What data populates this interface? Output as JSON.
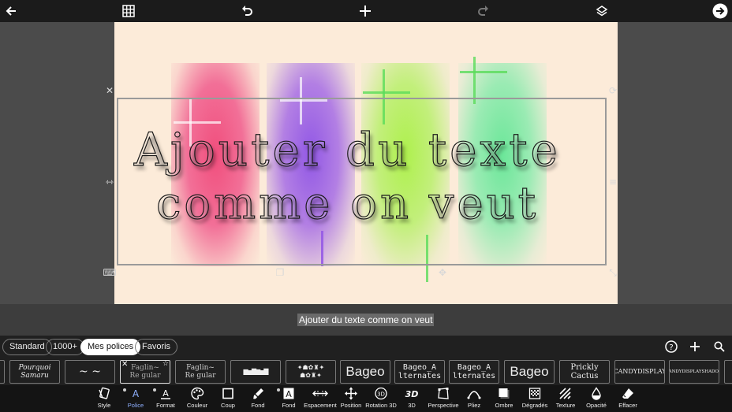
{
  "canvas": {
    "line1": "Ajouter du texte",
    "line2": "comme on veut"
  },
  "text_field": {
    "value": "Ajouter du texte comme on veut"
  },
  "categories": {
    "standard": "Standard",
    "thousand": "1000+",
    "mine": "Mes polices",
    "favorites": "Favoris"
  },
  "fonts": [
    {
      "label": "Pourquoi\nSamaru"
    },
    {
      "label": "~ ~"
    },
    {
      "label": "Faglin~\nRe gular"
    },
    {
      "label": "Faglin~\nRe gular"
    },
    {
      "label": "▆▅▇▆▅▇"
    },
    {
      "label": "✦☗✿♜✦\n☗✿♜✦"
    },
    {
      "label": "Bageo"
    },
    {
      "label": "Bageo_A\nlternates"
    },
    {
      "label": "Bageo_A\nlternates"
    },
    {
      "label": "Bageo"
    },
    {
      "label": "Prickly\nCactus"
    },
    {
      "label": "CANDYDISPLAY"
    },
    {
      "label": "CANDYDISPLAYSHADOW"
    }
  ],
  "tools": [
    {
      "name": "style",
      "label": "Style",
      "icon": "style-icon"
    },
    {
      "name": "police",
      "label": "Police",
      "icon": "font-icon",
      "active": true
    },
    {
      "name": "format",
      "label": "Format",
      "icon": "format-icon"
    },
    {
      "name": "couleur",
      "label": "Couleur",
      "icon": "palette-icon"
    },
    {
      "name": "coup",
      "label": "Coup",
      "icon": "stroke-icon"
    },
    {
      "name": "fond",
      "label": "Fond",
      "icon": "brush-icon"
    },
    {
      "name": "fond2",
      "label": "Fond",
      "icon": "text-bg-icon"
    },
    {
      "name": "espacement",
      "label": "Espacement",
      "icon": "spacing-icon"
    },
    {
      "name": "position",
      "label": "Position",
      "icon": "move-icon"
    },
    {
      "name": "rotation3d",
      "label": "Rotation 3D",
      "icon": "rotate-3d-icon"
    },
    {
      "name": "3d",
      "label": "3D",
      "icon": "3d-icon"
    },
    {
      "name": "perspective",
      "label": "Perspective",
      "icon": "perspective-icon"
    },
    {
      "name": "pliez",
      "label": "Pliez",
      "icon": "curve-icon"
    },
    {
      "name": "ombre",
      "label": "Ombre",
      "icon": "shadow-icon"
    },
    {
      "name": "degrades",
      "label": "Dégradés",
      "icon": "gradient-icon"
    },
    {
      "name": "texture",
      "label": "Texture",
      "icon": "texture-icon"
    },
    {
      "name": "opacite",
      "label": "Opacité",
      "icon": "opacity-icon"
    },
    {
      "name": "effacer",
      "label": "Effacer",
      "icon": "eraser-icon"
    }
  ],
  "colors": {
    "accent": "#8fb0ff",
    "canvas_bg": "#fcebd9"
  }
}
